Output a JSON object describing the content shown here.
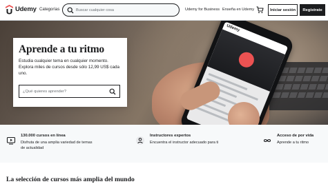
{
  "header": {
    "logo_text": "Udemy",
    "categories_label": "Categorías",
    "search_placeholder": "Buscar cualquier cosa",
    "business_label": "Udemy for Business",
    "teach_label": "Enseña en Udemy",
    "login_label": "Iniciar sesión",
    "signup_label": "Regístrate",
    "icons": {
      "search": "search-icon",
      "cart": "cart-icon"
    }
  },
  "hero": {
    "title": "Aprende a tu ritmo",
    "text": "Estudia cualquier tema en cualquier momento. Explora miles de cursos desde sólo 12,99 US$ cada uno.",
    "search_placeholder": "¿Qué quieres aprender?",
    "phone_logo": "Udemy"
  },
  "features": [
    {
      "icon": "play-screen-icon",
      "title": "130.000 cursos en línea",
      "subtitle": "Disfruta de una amplia variedad de temas de actualidad"
    },
    {
      "icon": "instructor-icon",
      "title": "Instructores expertos",
      "subtitle": "Encuentra el instructor adecuado para ti"
    },
    {
      "icon": "infinity-icon",
      "title": "Acceso de por vida",
      "subtitle": "Aprende a tu ritmo"
    }
  ],
  "section": {
    "title": "La selección de cursos más amplia del mundo"
  },
  "colors": {
    "brand": "#ec5252",
    "dark": "#1c1d1f",
    "signup_bg": "#1c1d1f",
    "features_bg": "#f7f9fa"
  }
}
